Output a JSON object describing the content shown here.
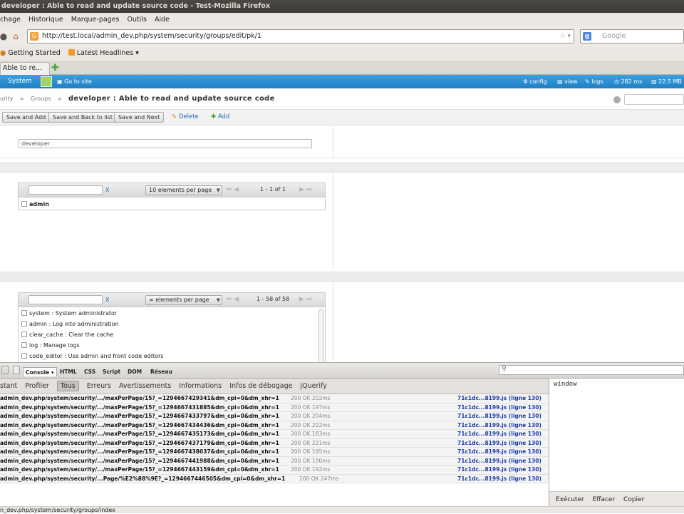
{
  "window": {
    "title": "developer : Able to read and update source code - Test-Mozilla Firefox"
  },
  "menu": [
    "chage",
    "Historique",
    "Marque-pages",
    "Outils",
    "Aide"
  ],
  "nav": {
    "url": "http://test.local/admin_dev.php/system/security/groups/edit/pk/1",
    "search_placeholder": "Google"
  },
  "bookmarks": [
    "Getting Started",
    "Latest Headlines"
  ],
  "tab": {
    "label": "Able to re..."
  },
  "dmbar": {
    "system": "System",
    "goto": "Go to site",
    "config": "config",
    "view": "view",
    "logs": "logs",
    "time": "282 ms",
    "memory": "22.5 MB"
  },
  "breadcrumb": {
    "part1": "urity",
    "sep": ">",
    "part2": "Groups",
    "title": "developer : Able to read and update source code"
  },
  "actions": {
    "save_add": "Save and Add",
    "save_back": "Save and Back to list",
    "save_next": "Save and Next",
    "delete": "Delete",
    "add": "Add"
  },
  "form": {
    "name_value": "developer"
  },
  "grid1": {
    "clear": "X",
    "per_page": "10 elements per page",
    "count": "1 - 1 of 1",
    "rows": [
      "admin"
    ]
  },
  "grid2": {
    "clear": "X",
    "per_page": "∞ elements per page",
    "count": "1 - 58 of 58",
    "rows": [
      "system : System administrator",
      "admin : Log into administration",
      "clear_cache : Clear the cache",
      "log : Manage logs",
      "code_editor : Use admin and front code editors"
    ]
  },
  "firebug": {
    "toolbar_tabs": [
      "Console ▾",
      "HTML",
      "CSS",
      "Script",
      "DOM",
      "Réseau"
    ],
    "tabs": [
      "stant",
      "Profiler",
      "Tous",
      "Erreurs",
      "Avertissements",
      "Informations",
      "Infos de débogage",
      "jQuerify"
    ],
    "active_tab": "Tous",
    "log": [
      {
        "url": "admin_dev.php/system/security/.../maxPerPage/15?_=1294667429341&dm_cpi=0&dm_xhr=1",
        "status": "200 OK 202ms",
        "src": "71c1dc...8199.js (ligne 130)"
      },
      {
        "url": "admin_dev.php/system/security/.../maxPerPage/15?_=1294667431885&dm_cpi=0&dm_xhr=1",
        "status": "200 OK 197ms",
        "src": "71c1dc...8199.js (ligne 130)"
      },
      {
        "url": "admin_dev.php/system/security/.../maxPerPage/15?_=1294667433797&dm_cpi=0&dm_xhr=1",
        "status": "200 OK 204ms",
        "src": "71c1dc...8199.js (ligne 130)"
      },
      {
        "url": "admin_dev.php/system/security/.../maxPerPage/15?_=1294667434436&dm_cpi=0&dm_xhr=1",
        "status": "200 OK 222ms",
        "src": "71c1dc...8199.js (ligne 130)"
      },
      {
        "url": "admin_dev.php/system/security/.../maxPerPage/15?_=1294667435173&dm_cpi=0&dm_xhr=1",
        "status": "200 OK 183ms",
        "src": "71c1dc...8199.js (ligne 130)"
      },
      {
        "url": "admin_dev.php/system/security/.../maxPerPage/15?_=1294667437179&dm_cpi=0&dm_xhr=1",
        "status": "200 OK 221ms",
        "src": "71c1dc...8199.js (ligne 130)"
      },
      {
        "url": "admin_dev.php/system/security/.../maxPerPage/15?_=1294667438037&dm_cpi=0&dm_xhr=1",
        "status": "200 OK 195ms",
        "src": "71c1dc...8199.js (ligne 130)"
      },
      {
        "url": "admin_dev.php/system/security/.../maxPerPage/15?_=1294667441988&dm_cpi=0&dm_xhr=1",
        "status": "200 OK 190ms",
        "src": "71c1dc...8199.js (ligne 130)"
      },
      {
        "url": "admin_dev.php/system/security/.../maxPerPage/15?_=1294667443159&dm_cpi=0&dm_xhr=1",
        "status": "200 OK 192ms",
        "src": "71c1dc...8199.js (ligne 130)"
      },
      {
        "url": "admin_dev.php/system/security/...Page/%E2%88%9E?_=1294667446505&dm_cpi=0&dm_xhr=1",
        "status": "200 OK 247ms",
        "src": "71c1dc...8199.js (ligne 130)"
      }
    ],
    "cmd_text": "window",
    "cmd_buttons": [
      "Exécuter",
      "Effacer",
      "Copier"
    ]
  },
  "status": {
    "text": "n_dev.php/system/security/groups/index"
  }
}
